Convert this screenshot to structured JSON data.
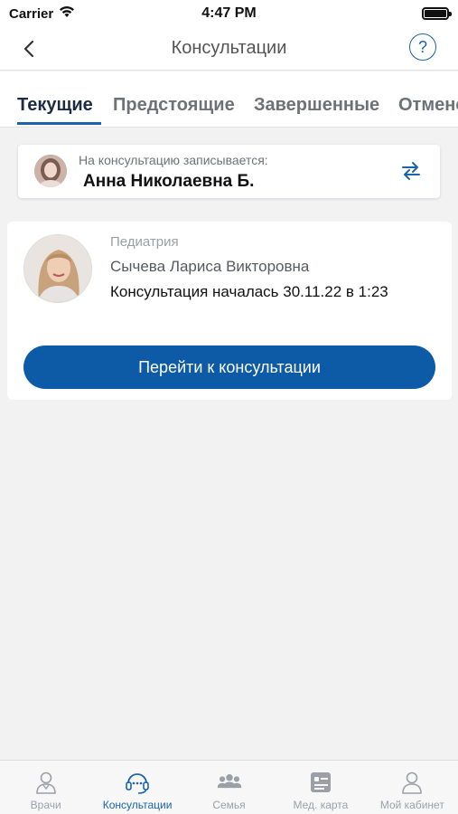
{
  "status_bar": {
    "carrier": "Carrier",
    "time": "4:47 PM"
  },
  "nav": {
    "title": "Консультации",
    "help_symbol": "?",
    "back_icon": "chevron-left-icon"
  },
  "tabs": [
    {
      "label": "Текущие",
      "active": true
    },
    {
      "label": "Предстоящие",
      "active": false
    },
    {
      "label": "Завершенные",
      "active": false
    },
    {
      "label": "Отменённые",
      "active": false
    }
  ],
  "patient": {
    "caption": "На консультацию записывается:",
    "name": "Анна Николаевна Б.",
    "swap_icon": "swap-arrows-icon"
  },
  "consultation": {
    "specialty": "Педиатрия",
    "doctor_name": "Сычева Лариса Викторовна",
    "status": "Консультация началась 30.11.22 в 1:23",
    "button_label": "Перейти к консультации"
  },
  "bottom_nav": [
    {
      "label": "Врачи",
      "icon": "doctor-icon",
      "active": false
    },
    {
      "label": "Консультации",
      "icon": "headset-icon",
      "active": true
    },
    {
      "label": "Семья",
      "icon": "family-icon",
      "active": false
    },
    {
      "label": "Мед. карта",
      "icon": "medical-card-icon",
      "active": false
    },
    {
      "label": "Мой кабинет",
      "icon": "profile-icon",
      "active": false
    }
  ],
  "colors": {
    "accent": "#1a64ad",
    "button": "#0d5aa7",
    "background": "#f2f2f3",
    "inactive": "#9ca0a6"
  }
}
